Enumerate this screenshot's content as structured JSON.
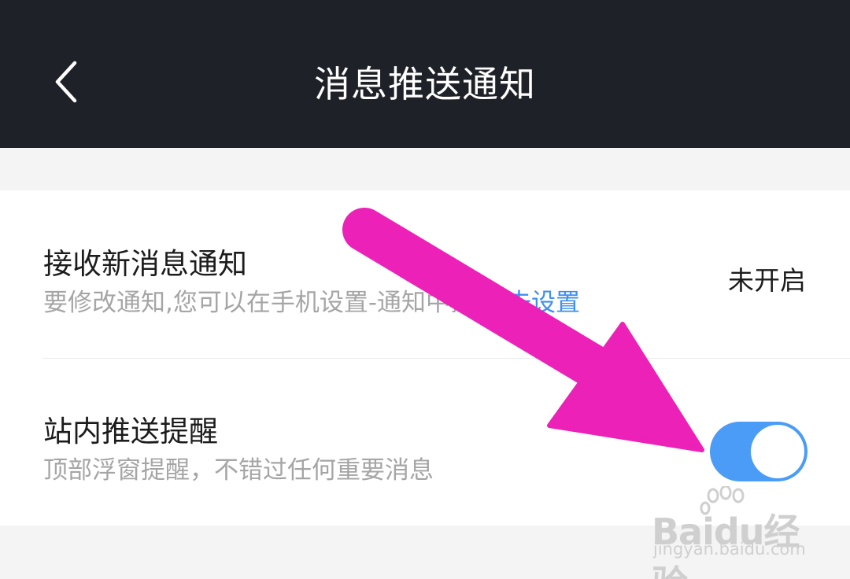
{
  "header": {
    "title": "消息推送通知"
  },
  "settings": [
    {
      "title": "接收新消息通知",
      "subtitle": "要修改通知,您可以在手机设置-通知中操作",
      "link": "去设置",
      "status": "未开启"
    },
    {
      "title": "站内推送提醒",
      "subtitle": "顶部浮窗提醒，不错过任何重要消息",
      "toggle_on": true
    }
  ],
  "watermark": {
    "brand": "Baidu经验",
    "url": "jingyan.baidu.com"
  },
  "colors": {
    "header_bg": "#1f2129",
    "accent": "#4a9cf6",
    "link": "#3d8ff0",
    "arrow": "#ec21b8"
  },
  "icons": {
    "back": "chevron-left-icon",
    "overlay": "annotation-arrow-icon"
  }
}
